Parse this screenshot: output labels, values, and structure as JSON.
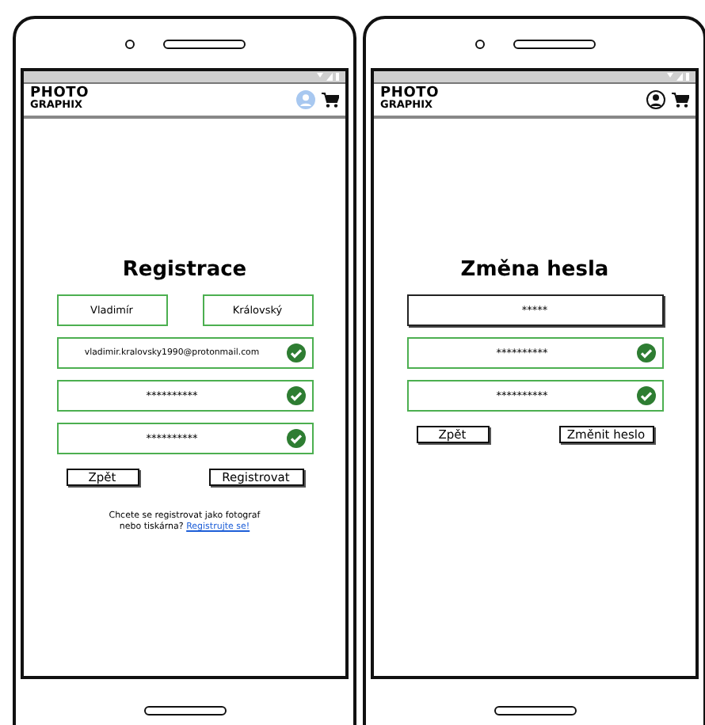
{
  "phones": [
    {
      "header": {
        "logo_top": "PHOTO",
        "logo_bottom": "GRAPHIX",
        "user_icon_active": true
      },
      "title": "Registrace",
      "rows": [
        {
          "fields": [
            {
              "value": "Vladimír",
              "valid": true,
              "check": false
            },
            {
              "value": "Královský",
              "valid": true,
              "check": false
            }
          ]
        },
        {
          "fields": [
            {
              "value": "vladimir.kralovsky1990@protonmail.com",
              "valid": true,
              "check": true
            }
          ]
        },
        {
          "fields": [
            {
              "value": "**********",
              "valid": true,
              "check": true
            }
          ]
        },
        {
          "fields": [
            {
              "value": "**********",
              "valid": true,
              "check": true
            }
          ]
        }
      ],
      "buttons": [
        "Zpět",
        "Registrovat"
      ],
      "note": {
        "text": "Chcete se registrovat jako fotograf nebo tiskárna?",
        "link": "Registrujte se!"
      }
    },
    {
      "header": {
        "logo_top": "PHOTO",
        "logo_bottom": "GRAPHIX",
        "user_icon_active": false
      },
      "title": "Změna hesla",
      "rows": [
        {
          "fields": [
            {
              "value": "*****",
              "valid": false,
              "check": false
            }
          ]
        },
        {
          "fields": [
            {
              "value": "**********",
              "valid": true,
              "check": true
            }
          ]
        },
        {
          "fields": [
            {
              "value": "**********",
              "valid": true,
              "check": true
            }
          ]
        }
      ],
      "buttons": [
        "Zpět",
        "Změnit heslo"
      ]
    }
  ]
}
